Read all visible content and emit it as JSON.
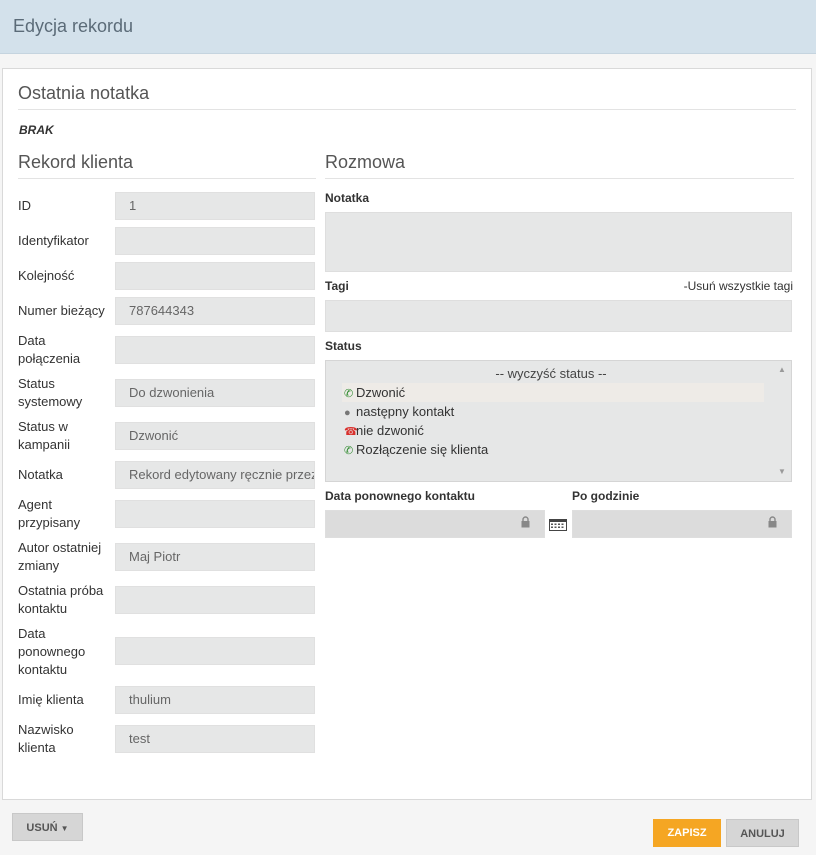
{
  "window": {
    "title": "Edycja rekordu"
  },
  "last_note": {
    "title": "Ostatnia notatka",
    "value": "BRAK"
  },
  "record": {
    "title": "Rekord klienta",
    "fields": [
      {
        "label": "ID",
        "value": "1"
      },
      {
        "label": "Identyfikator",
        "value": ""
      },
      {
        "label": "Kolejność",
        "value": ""
      },
      {
        "label": "Numer bieżący",
        "value": "787644343"
      },
      {
        "label": "Data połączenia",
        "value": ""
      },
      {
        "label": "Status systemowy",
        "value": "Do dzwonienia"
      },
      {
        "label": "Status w kampanii",
        "value": "Dzwonić"
      },
      {
        "label": "Notatka",
        "value": "Rekord edytowany ręcznie przez"
      },
      {
        "label": "Agent przypisany",
        "value": ""
      },
      {
        "label": "Autor ostatniej zmiany",
        "value": "Maj Piotr"
      },
      {
        "label": "Ostatnia próba kontaktu",
        "value": ""
      },
      {
        "label": "Data ponownego kontaktu",
        "value": ""
      },
      {
        "label": "Imię klienta",
        "value": "thulium"
      },
      {
        "label": "Nazwisko klienta",
        "value": "test"
      }
    ]
  },
  "conversation": {
    "title": "Rozmowa",
    "note_label": "Notatka",
    "note_value": "",
    "tags_label": "Tagi",
    "remove_tags_label": "-Usuń wszystkie tagi",
    "status_label": "Status",
    "status_clear": "-- wyczyść status --",
    "status_options": [
      {
        "label": "Dzwonić",
        "icon": "phone-green-icon",
        "color": "#2e8b2e"
      },
      {
        "label": "następny kontakt",
        "icon": "person-icon",
        "color": "#777777"
      },
      {
        "label": "nie dzwonić",
        "icon": "phone-hangup-red-icon",
        "color": "#d9302c"
      },
      {
        "label": "Rozłączenie się klienta",
        "icon": "phone-green-icon",
        "color": "#2e8b2e"
      }
    ],
    "recontact_label": "Data ponownego kontaktu",
    "after_hour_label": "Po godzinie"
  },
  "footer": {
    "delete_label": "USUŃ",
    "save_label": "ZAPISZ",
    "cancel_label": "ANULUJ"
  },
  "colors": {
    "header_bg": "#d3e1eb",
    "save_bg": "#f5a623",
    "field_bg": "#e6e7e7"
  }
}
